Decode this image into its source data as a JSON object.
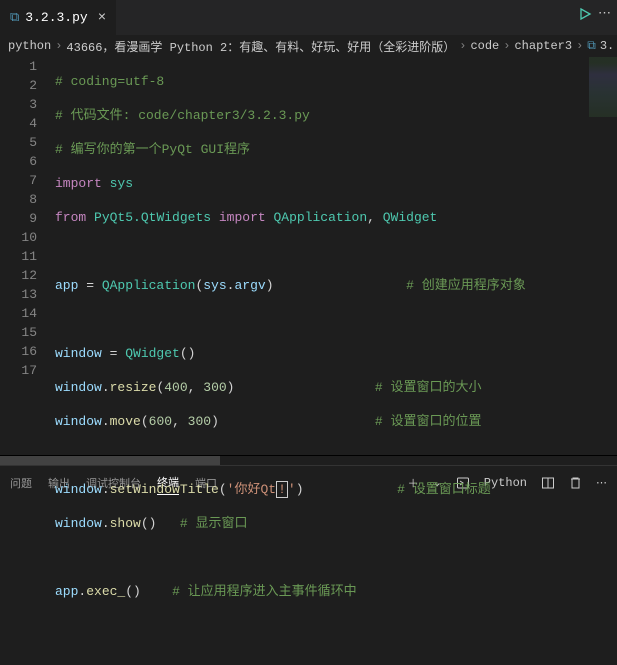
{
  "tab": {
    "icon_glyph": "⧉",
    "label": "3.2.3.py",
    "close_glyph": "×"
  },
  "run": {
    "dots_glyph": "⋯"
  },
  "breadcrumb": {
    "sep": "›",
    "segments": [
      "python",
      "43666，看漫画学 Python 2：有趣、有料、好玩、好用（全彩进阶版）",
      "code",
      "chapter3",
      "3..."
    ],
    "last_icon_color": "#519aba"
  },
  "gutter": [
    "1",
    "2",
    "3",
    "4",
    "5",
    "6",
    "7",
    "8",
    "9",
    "10",
    "11",
    "12",
    "13",
    "14",
    "15",
    "16",
    "17"
  ],
  "code": {
    "l1": "# coding=utf-8",
    "l2": "# 代码文件: code/chapter3/3.2.3.py",
    "l3": "# 编写你的第一个PyQt GUI程序",
    "l4_import": "import",
    "l4_sys": "sys",
    "l5_from": "from",
    "l5_mod": "PyQt5.QtWidgets",
    "l5_import": "import",
    "l5_a": "QApplication",
    "l5_b": "QWidget",
    "l7_var": "app",
    "l7_eq": " = ",
    "l7_cls": "QApplication",
    "l7_arg1": "sys",
    "l7_arg2": "argv",
    "l7_cmt": "# 创建应用程序对象",
    "l9_var": "window",
    "l9_eq": " = ",
    "l9_cls": "QWidget",
    "l10_obj": "window",
    "l10_fn": "resize",
    "l10_a": "400",
    "l10_b": "300",
    "l10_cmt": "# 设置窗口的大小",
    "l11_obj": "window",
    "l11_fn": "move",
    "l11_a": "600",
    "l11_b": "300",
    "l11_cmt": "# 设置窗口的位置",
    "l13_obj": "window",
    "l13_fn": "setWindowTitle",
    "l13_s1": "'你好Qt",
    "l13_box": "!",
    "l13_s2": "'",
    "l13_cmt": "# 设置窗口标题",
    "l14_obj": "window",
    "l14_fn": "show",
    "l14_cmt": "# 显示窗口",
    "l16_obj": "app",
    "l16_fn": "exec_",
    "l16_cmt": "# 让应用程序进入主事件循环中"
  },
  "panel": {
    "tabs": {
      "problems": "问题",
      "output": "输出",
      "debug": "调试控制台",
      "terminal": "终端",
      "ports": "端口"
    },
    "actions": {
      "plus_glyph": "＋",
      "chevron_glyph": "⌄",
      "kernel_glyph": "▷",
      "kernel_label": "Python",
      "split_glyph": "▥",
      "trash_glyph": "🗑",
      "more_glyph": "⋯"
    }
  }
}
